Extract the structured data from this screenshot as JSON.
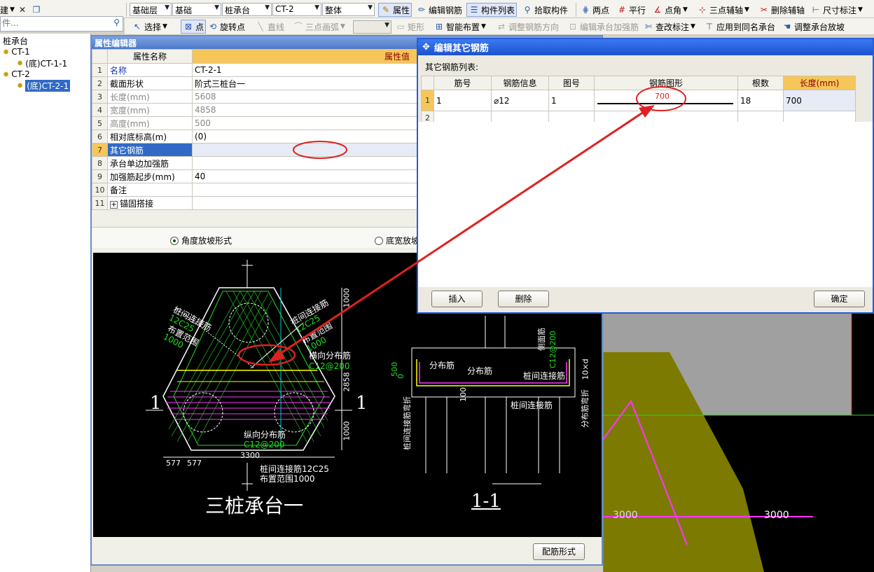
{
  "toolbar1": {
    "left_menu": "建",
    "close_icon": "✕",
    "search_placeholder": "件...",
    "floor_select": "基础层",
    "category_select": "基础",
    "type_select": "桩承台",
    "name_select": "CT-2",
    "scope_select": "整体",
    "btn_property": "属性",
    "btn_edit_rebar": "编辑钢筋",
    "btn_component_list": "构件列表",
    "btn_pick": "拾取构件",
    "btn_two_points": "两点",
    "btn_parallel": "平行",
    "btn_point_angle": "点角",
    "btn_three_point_axis": "三点辅轴",
    "btn_delete_axis": "删除辅轴",
    "btn_dimension": "尺寸标注"
  },
  "toolbar2": {
    "btn_select": "选择",
    "btn_point": "点",
    "btn_rotate_point": "旋转点",
    "btn_line": "直线",
    "btn_three_point_arc": "三点画弧",
    "btn_rect": "矩形",
    "btn_smart_layout": "智能布置",
    "btn_adjust_direction": "调整钢筋方向",
    "btn_edit_reinforce": "编辑承台加强筋",
    "btn_check_label": "查改标注",
    "btn_apply_same": "应用到同名承台",
    "btn_adjust_slope": "调整承台放坡"
  },
  "tree": {
    "root": "桩承台",
    "items": [
      {
        "label": "CT-1",
        "child": "(底)CT-1-1"
      },
      {
        "label": "CT-2",
        "child": "(底)CT-2-1"
      }
    ]
  },
  "prop_editor": {
    "title": "属性编辑器",
    "col_name": "属性名称",
    "col_value": "属性值",
    "rows": [
      {
        "n": "1",
        "name": "名称",
        "value": "CT-2-1"
      },
      {
        "n": "2",
        "name": "截面形状",
        "value": "阶式三桩台一"
      },
      {
        "n": "3",
        "name": "长度(mm)",
        "value": "5608"
      },
      {
        "n": "4",
        "name": "宽度(mm)",
        "value": "4858"
      },
      {
        "n": "5",
        "name": "高度(mm)",
        "value": "500"
      },
      {
        "n": "6",
        "name": "相对底标高(m)",
        "value": "(0)"
      },
      {
        "n": "7",
        "name": "其它钢筋",
        "value": ""
      },
      {
        "n": "8",
        "name": "承台单边加强筋",
        "value": ""
      },
      {
        "n": "9",
        "name": "加强筋起步(mm)",
        "value": "40"
      },
      {
        "n": "10",
        "name": "备注",
        "value": ""
      },
      {
        "n": "11",
        "name": "锚固搭接",
        "value": ""
      }
    ],
    "expand_icon": "+",
    "radio1": "角度放坡形式",
    "radio2": "底宽放坡",
    "btn_rebar_form": "配筋形式"
  },
  "drawing": {
    "title": "三桩承台一",
    "section": "1-1",
    "label_one": "1",
    "dims": {
      "d1000a": "1000",
      "d2858": "2858",
      "d1000b": "1000",
      "d3300": "3300",
      "d577a": "577",
      "d577b": "577",
      "d500": "500",
      "d0": "0",
      "d100": "100",
      "d10d": "10×d"
    },
    "notes": {
      "conn_left_1": "桩间连接筋",
      "conn_left_2": "12C25",
      "conn_left_3": "布置范围",
      "conn_left_4": "1000",
      "conn_right_1": "桩间连接筋",
      "conn_right_2": "12C25",
      "conn_right_3": "布置范围",
      "conn_right_4": "1000",
      "horiz_1": "横向分布筋",
      "horiz_2": "C12@200",
      "vert_1": "纵向分布筋",
      "vert_2": "C12@200",
      "bottom_1": "桩间连接筋12C25",
      "bottom_2": "布置范围1000",
      "sec_dist1": "分布筋",
      "sec_dist2": "分布筋",
      "sec_conn1": "桩间连接筋",
      "sec_conn2": "桩间连接筋",
      "sec_side": "侧面筋",
      "sec_side2": "C12@200",
      "sec_bend_left": "桩间连接筋弯折",
      "sec_bend_right": "分布筋弯折"
    }
  },
  "dialog": {
    "title": "编辑其它钢筋",
    "list_label": "其它钢筋列表:",
    "headers": [
      "筋号",
      "钢筋信息",
      "图号",
      "钢筋图形",
      "根数",
      "长度(mm)"
    ],
    "rows": [
      {
        "n": "1",
        "bar": "1",
        "info": "⌀12",
        "fig": "1",
        "shape": "700",
        "count": "18",
        "length": "700"
      },
      {
        "n": "2",
        "bar": "",
        "info": "",
        "fig": "",
        "shape": "",
        "count": "",
        "length": ""
      }
    ],
    "btn_insert": "插入",
    "btn_delete": "删除",
    "btn_ok": "确定"
  },
  "rightcad": {
    "label_a": "3000",
    "label_b": "3000"
  },
  "colors": {
    "annotation": "#e02020",
    "cad_green": "#22dd22",
    "cad_magenta": "#ff33ff",
    "cad_yellow": "#ffff00",
    "cad_olive": "#7c7a00"
  }
}
